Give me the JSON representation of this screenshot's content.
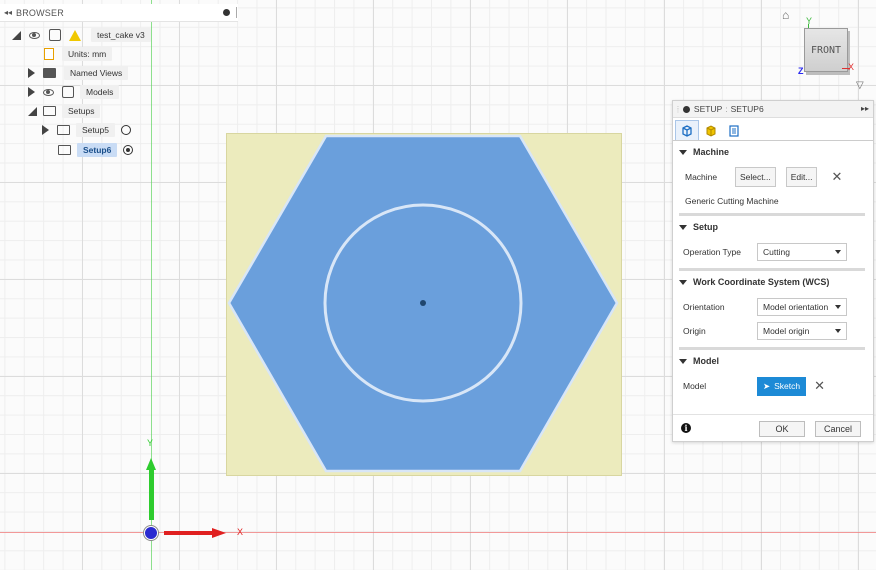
{
  "browser": {
    "header": "BROWSER",
    "items": [
      {
        "label": "test_cake v3"
      },
      {
        "label": "Units: mm"
      },
      {
        "label": "Named Views"
      },
      {
        "label": "Models"
      },
      {
        "label": "Setups"
      },
      {
        "label": "Setup5"
      },
      {
        "label": "Setup6"
      }
    ]
  },
  "viewcube": {
    "face": "FRONT",
    "axis_x": "X",
    "axis_y": "Y",
    "axis_z": "Z"
  },
  "panel": {
    "header_prefix": "SETUP",
    "header_name": "SETUP6",
    "machine": {
      "title": "Machine",
      "label": "Machine",
      "select_btn": "Select...",
      "edit_btn": "Edit...",
      "machine_name": "Generic Cutting Machine"
    },
    "setup": {
      "title": "Setup",
      "operation_type_label": "Operation Type",
      "operation_type_value": "Cutting"
    },
    "wcs": {
      "title": "Work Coordinate System (WCS)",
      "orientation_label": "Orientation",
      "orientation_value": "Model orientation",
      "origin_label": "Origin",
      "origin_value": "Model origin"
    },
    "model": {
      "title": "Model",
      "label": "Model",
      "value": "Sketch"
    },
    "ok": "OK",
    "cancel": "Cancel"
  },
  "triad": {
    "x": "X",
    "y": "Y"
  },
  "colors": {
    "accent": "#1d8ad6",
    "model_fill": "#6a9fdc",
    "stock_fill": "#ecebbd"
  }
}
